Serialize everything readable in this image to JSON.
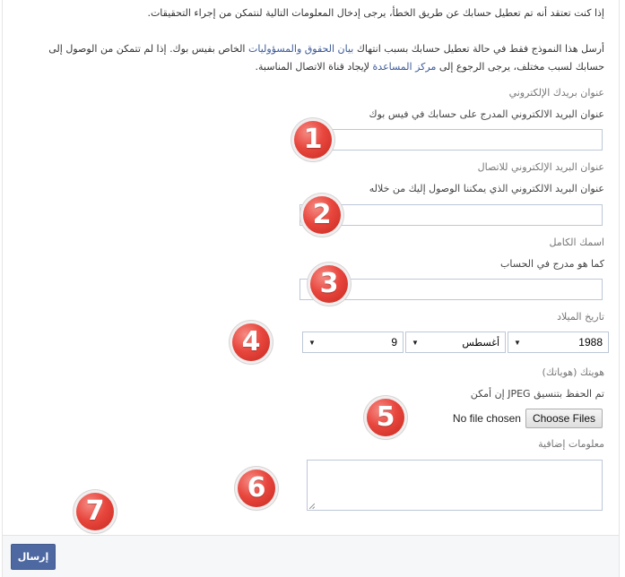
{
  "intro": {
    "line1": "إذا كنت تعتقد أنه تم تعطيل حسابك عن طريق الخطأ، يرجى إدخال المعلومات التالية لنتمكن من إجراء التحقيقات.",
    "line2_part1": "أرسل هذا النموذج فقط في حالة تعطيل حسابك بسبب انتهاك ",
    "line2_link1": "بيان الحقوق والمسؤوليات",
    "line2_part2": " الخاص بفيس بوك. إذا لم تتمكن من الوصول إلى حسابك لسبب مختلف، يرجى الرجوع إلى ",
    "line2_link2": "مركز المساعدة",
    "line2_part3": " لإيجاد قناة الاتصال المناسبة."
  },
  "fields": {
    "login_email": {
      "label": "عنوان بريدك الإلكتروني",
      "hint": "عنوان البريد الالكتروني المدرج على حسابك في فيس بوك",
      "value": ""
    },
    "contact_email": {
      "label": "عنوان البريد الإلكتروني للاتصال",
      "hint": "عنوان البريد الالكتروني الذي يمكننا الوصول إليك من خلاله",
      "value": ""
    },
    "full_name": {
      "label": "اسمك الكامل",
      "hint": "كما هو مدرج في الحساب",
      "value": ""
    },
    "birthday": {
      "label": "تاريخ الميلاد",
      "year": "1988",
      "month": "أغسطس",
      "day": "9"
    },
    "id_upload": {
      "label": "هويتك (هوياتك)",
      "hint": "تم الحفظ بتنسيق JPEG إن أمكن",
      "status": "No file chosen",
      "button": "Choose Files"
    },
    "additional_info": {
      "label": "معلومات إضافية",
      "value": ""
    }
  },
  "badges": [
    "1",
    "2",
    "3",
    "4",
    "5",
    "6",
    "7"
  ],
  "footer": {
    "submit_label": "إرسال"
  },
  "colors": {
    "link": "#3b5998",
    "submit_bg": "#4e69a2",
    "badge_red": "#e8473e",
    "input_border": "#bdc7d8"
  }
}
